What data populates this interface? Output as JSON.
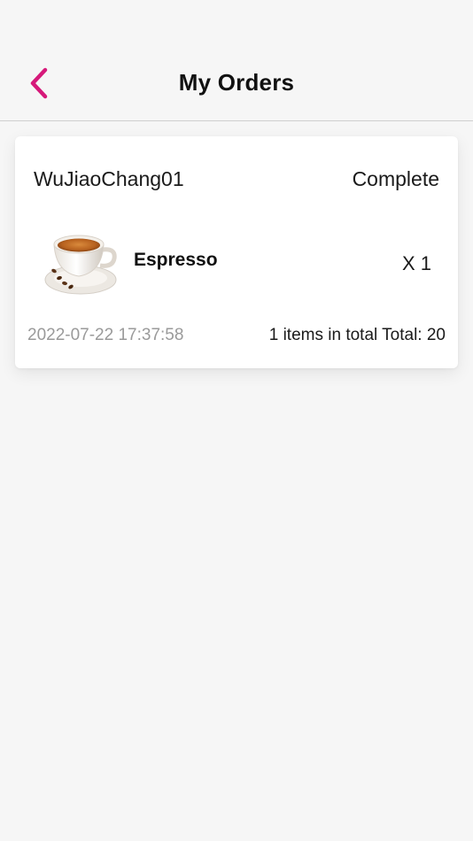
{
  "header": {
    "title": "My Orders",
    "back_icon": "chevron-left-icon",
    "accent_color": "#d6197a"
  },
  "orders": [
    {
      "store": "WuJiaoChang01",
      "status": "Complete",
      "item": {
        "name": "Espresso",
        "quantity": "X 1",
        "image_icon": "coffee-cup-icon"
      },
      "time": "2022-07-22 17:37:58",
      "summary": "1 items in total Total: 20"
    }
  ]
}
